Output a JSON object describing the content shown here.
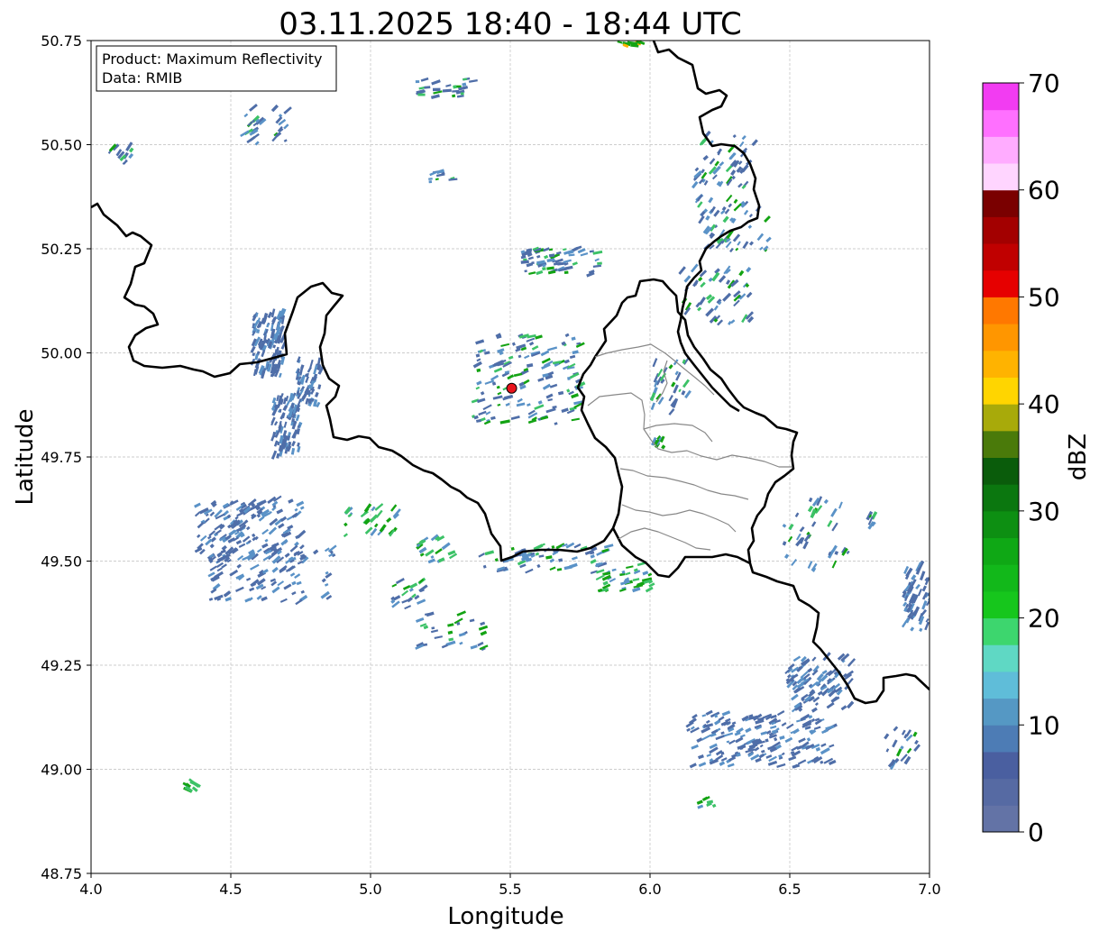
{
  "title": "03.11.2025 18:40 - 18:44 UTC",
  "info_box": {
    "product": "Product: Maximum Reflectivity",
    "source": "Data: RMIB"
  },
  "axes": {
    "xlabel": "Longitude",
    "ylabel": "Latitude",
    "xlim": [
      4.0,
      7.0
    ],
    "ylim": [
      48.75,
      50.75
    ],
    "x_ticks": [
      {
        "value": 4.0,
        "label": "4.0"
      },
      {
        "value": 4.5,
        "label": "4.5"
      },
      {
        "value": 5.0,
        "label": "5.0"
      },
      {
        "value": 5.5,
        "label": "5.5"
      },
      {
        "value": 6.0,
        "label": "6.0"
      },
      {
        "value": 6.5,
        "label": "6.5"
      },
      {
        "value": 7.0,
        "label": "7.0"
      }
    ],
    "y_ticks": [
      {
        "value": 48.75,
        "label": "48.75"
      },
      {
        "value": 49.0,
        "label": "49.00"
      },
      {
        "value": 49.25,
        "label": "49.25"
      },
      {
        "value": 49.5,
        "label": "49.50"
      },
      {
        "value": 49.75,
        "label": "49.75"
      },
      {
        "value": 50.0,
        "label": "50.00"
      },
      {
        "value": 50.25,
        "label": "50.25"
      },
      {
        "value": 50.5,
        "label": "50.50"
      },
      {
        "value": 50.75,
        "label": "50.75"
      }
    ],
    "grid": true
  },
  "radar_site": {
    "lon": 5.505,
    "lat": 49.915,
    "color": "#e8141c"
  },
  "colorbar": {
    "label": "dBZ",
    "min": 0,
    "max": 70,
    "tick_labels": [
      "0",
      "10",
      "20",
      "30",
      "40",
      "50",
      "60",
      "70"
    ],
    "colors": [
      "#6373a6",
      "#566aa3",
      "#4a5fa0",
      "#4d7cb5",
      "#5598c4",
      "#5fbdd9",
      "#5fd8c4",
      "#3dd66e",
      "#16c61c",
      "#12b81a",
      "#0fa815",
      "#0d8f12",
      "#0b770f",
      "#0a5c0b",
      "#4a7a0a",
      "#a8aa0a",
      "#ffd500",
      "#ffb300",
      "#ff9600",
      "#ff7800",
      "#e60000",
      "#c00000",
      "#a30000",
      "#7a0000",
      "#ffd5ff",
      "#ffacff",
      "#ff70ff",
      "#f23cf2"
    ]
  },
  "echo_colors": {
    "light": "#4f6ea8",
    "weak": "#5a92c7",
    "moderate": "#3cc267",
    "strong": "#13a313",
    "intense": "#ffb300"
  },
  "border_color": "#000000",
  "province_color": "#888888"
}
